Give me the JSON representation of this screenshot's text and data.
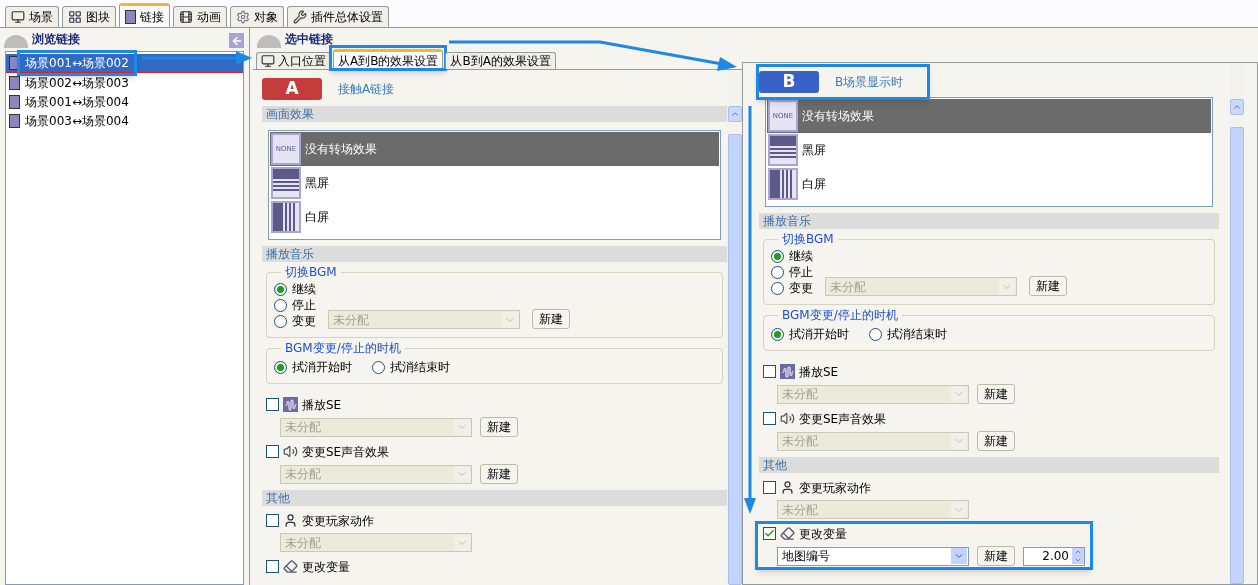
{
  "top_tabs": [
    {
      "label": "场景",
      "selected": false
    },
    {
      "label": "图块",
      "selected": false
    },
    {
      "label": "链接",
      "selected": true
    },
    {
      "label": "动画",
      "selected": false
    },
    {
      "label": "对象",
      "selected": false
    },
    {
      "label": "插件总体设置",
      "selected": false
    }
  ],
  "browse_panel": {
    "title": "浏览链接",
    "links": [
      {
        "label": "场景001↔场景002",
        "selected": true
      },
      {
        "label": "场景002↔场景003",
        "selected": false
      },
      {
        "label": "场景001↔场景004",
        "selected": false
      },
      {
        "label": "场景003↔场景004",
        "selected": false
      }
    ]
  },
  "selected_panel": {
    "title": "选中链接",
    "tabs": [
      {
        "label": "入口位置",
        "selected": false
      },
      {
        "label": "从A到B的效果设置",
        "selected": true
      },
      {
        "label": "从B到A的效果设置",
        "selected": false
      }
    ]
  },
  "panels": [
    {
      "badge": "A",
      "color": "#c43c3c",
      "title": "接触A链接",
      "screen_effect": {
        "title": "画面效果",
        "options": [
          {
            "label": "没有转场效果",
            "kind": "none",
            "icon_text": "NONE",
            "selected": true
          },
          {
            "label": "黑屏",
            "kind": "black",
            "selected": false
          },
          {
            "label": "白屏",
            "kind": "white",
            "selected": false
          }
        ]
      },
      "music": {
        "title": "播放音乐",
        "bgm_switch": {
          "title": "切换BGM",
          "options": [
            {
              "label": "继续",
              "selected": true
            },
            {
              "label": "停止",
              "selected": false
            },
            {
              "label": "变更",
              "selected": false
            }
          ],
          "select": {
            "value": "未分配",
            "disabled": true
          },
          "button": "新建"
        },
        "timing": {
          "title": "BGM变更/停止的时机",
          "options": [
            {
              "label": "拭消开始时",
              "selected": true
            },
            {
              "label": "拭消结束时",
              "selected": false
            }
          ]
        },
        "items": [
          {
            "label": "播放SE",
            "kind": "wave",
            "checked": false,
            "select": {
              "value": "未分配",
              "disabled": true
            },
            "button": "新建"
          },
          {
            "label": "变更SE声音效果",
            "kind": "speaker",
            "checked": false,
            "select": {
              "value": "未分配",
              "disabled": true
            },
            "button": "新建"
          }
        ]
      },
      "other": {
        "title": "其他",
        "items": [
          {
            "label": "变更玩家动作",
            "kind": "player",
            "checked": false,
            "select": {
              "value": "未分配",
              "disabled": true
            }
          },
          {
            "label": "更改变量",
            "kind": "eraser",
            "checked": false
          }
        ]
      }
    },
    {
      "badge": "B",
      "color": "#3a62c6",
      "title": "B场景显示时",
      "screen_effect": {
        "options": [
          {
            "label": "没有转场效果",
            "kind": "none",
            "icon_text": "NONE",
            "selected": true
          },
          {
            "label": "黑屏",
            "kind": "black",
            "selected": false
          },
          {
            "label": "白屏",
            "kind": "white",
            "selected": false
          }
        ]
      },
      "music": {
        "title": "播放音乐",
        "bgm_switch": {
          "title": "切换BGM",
          "options": [
            {
              "label": "继续",
              "selected": true
            },
            {
              "label": "停止",
              "selected": false
            },
            {
              "label": "变更",
              "selected": false
            }
          ],
          "select": {
            "value": "未分配",
            "disabled": true
          },
          "button": "新建"
        },
        "timing": {
          "title": "BGM变更/停止的时机",
          "options": [
            {
              "label": "拭消开始时",
              "selected": true
            },
            {
              "label": "拭消结束时",
              "selected": false
            }
          ]
        },
        "items": [
          {
            "label": "播放SE",
            "kind": "wave",
            "checked": false,
            "select": {
              "value": "未分配",
              "disabled": true
            },
            "button": "新建"
          },
          {
            "label": "变更SE声音效果",
            "kind": "speaker",
            "checked": false,
            "select": {
              "value": "未分配",
              "disabled": true
            },
            "button": "新建"
          }
        ]
      },
      "other": {
        "title": "其他",
        "items": [
          {
            "label": "变更玩家动作",
            "kind": "player",
            "checked": false,
            "select": {
              "value": "未分配",
              "disabled": true
            }
          },
          {
            "label": "更改变量",
            "kind": "eraser",
            "checked": true,
            "select": {
              "value": "地图编号",
              "disabled": false
            },
            "button": "新建",
            "number": "2.00"
          }
        ]
      }
    }
  ]
}
